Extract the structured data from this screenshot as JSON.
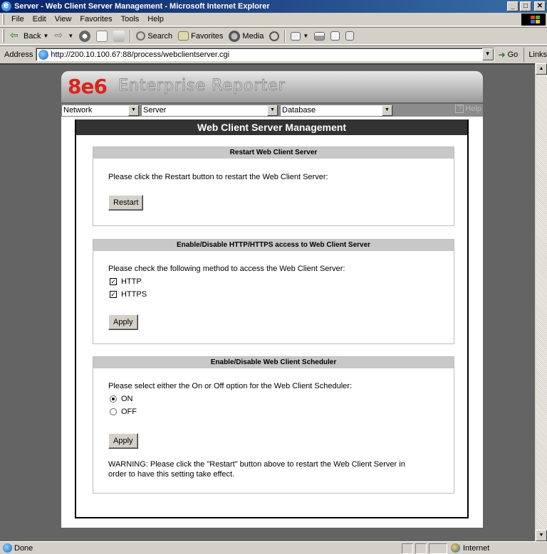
{
  "window": {
    "title": "Server - Web Client Server Management - Microsoft Internet Explorer",
    "minimize": "_",
    "maximize": "□",
    "close": "✕"
  },
  "menu": [
    "File",
    "Edit",
    "View",
    "Favorites",
    "Tools",
    "Help"
  ],
  "toolbar": {
    "back": "Back",
    "search": "Search",
    "favorites": "Favorites",
    "media": "Media"
  },
  "address": {
    "label": "Address",
    "url": "http://200.10.100.67:88/process/webclientserver.cgi",
    "go": "Go",
    "links": "Links"
  },
  "app": {
    "logo_number": "8e6",
    "logo_name": "Enterprise Reporter",
    "nav": {
      "network": "Network",
      "server": "Server",
      "database": "Database",
      "help": "Help",
      "help_icon": "?"
    },
    "page_title": "Web Client Server Management"
  },
  "restart_panel": {
    "heading": "Restart Web Client Server",
    "instruction": "Please click the Restart button to restart the Web Client Server:",
    "button": "Restart"
  },
  "access_panel": {
    "heading": "Enable/Disable HTTP/HTTPS access to Web Client Server",
    "instruction": "Please check the following method to access the Web Client Server:",
    "options": [
      {
        "label": "HTTP",
        "checked": true
      },
      {
        "label": "HTTPS",
        "checked": true
      }
    ],
    "button": "Apply"
  },
  "scheduler_panel": {
    "heading": "Enable/Disable Web Client Scheduler",
    "instruction": "Please select either the On or Off option for the Web Client Scheduler:",
    "options": [
      {
        "label": "ON",
        "selected": true
      },
      {
        "label": "OFF",
        "selected": false
      }
    ],
    "button": "Apply",
    "warning_line1": "WARNING: Please click the \"Restart\" button above to restart the Web Client Server in",
    "warning_line2": "order to have this setting take effect."
  },
  "status": {
    "text": "Done",
    "zone": "Internet"
  },
  "colors": {
    "title_bar": "#0a246a",
    "brand_red": "#d9251c",
    "page_title_bg": "#333333",
    "panel_heading_bg": "#c8c8c8",
    "viewport_bg": "#646464"
  }
}
